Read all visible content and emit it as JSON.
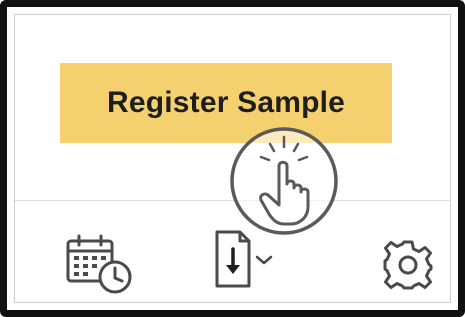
{
  "toolbar_top": {
    "register_button_label": "Register Sample",
    "register_button_color": "#f4d06f"
  },
  "tap_indicator": {
    "icon": "tap-hand-icon"
  },
  "toolbar_bottom": {
    "icons": [
      "calendar-clock-icon",
      "download-icon",
      "chevron-down-icon",
      "gear-icon"
    ]
  },
  "colors": {
    "frame": "#111111",
    "background": "#ffffff",
    "icon_stroke": "#4a4a4a"
  }
}
